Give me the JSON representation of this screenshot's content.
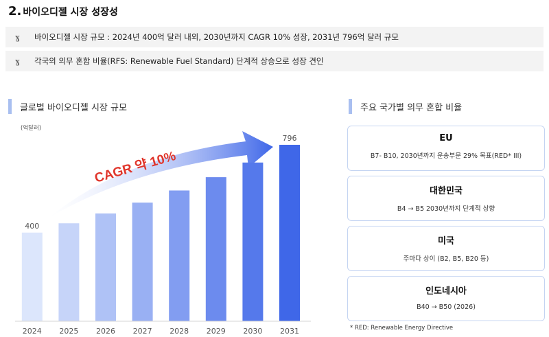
{
  "header": {
    "number": "2.",
    "title": "바이오디젤 시장 성장성"
  },
  "summary": [
    {
      "icon": "ɣ",
      "text": "바이오디젤 시장 규모 : 2024년 400억 달러 내외, 2030년까지 CAGR 10% 성장, 2031년 796억 달러 규모"
    },
    {
      "icon": "ɣ",
      "text": "각국의 의무 혼합 비율(RFS: Renewable Fuel Standard) 단계적 상승으로 성장 견인"
    }
  ],
  "left_section": {
    "title": "글로벌 바이오디젤 시장 규모",
    "unit": "(억달러)"
  },
  "right_section": {
    "title": "주요 국가별 의무 혼합 비율"
  },
  "countries": [
    {
      "name": "EU",
      "desc": "B7- B10, 2030년까지 운송부문 29% 목표(RED* III)"
    },
    {
      "name": "대한민국",
      "desc": "B4 → B5 2030년까지 단계적 상향"
    },
    {
      "name": "미국",
      "desc": "주마다 상이 (B2, B5, B20 등)"
    },
    {
      "name": "인도네시아",
      "desc": "B40 → B50 (2026)"
    }
  ],
  "footnote": "* RED: Renewable Energy Directive",
  "colors": {
    "accent_bar": "#a9bff0",
    "box_border": "#c4d4f2",
    "bar_light": "#dce6fc",
    "bar_dark": "#3f67e8",
    "cagr_text": "#e0352b"
  },
  "chart_data": {
    "type": "bar",
    "categories": [
      "2024",
      "2025",
      "2026",
      "2027",
      "2028",
      "2029",
      "2030",
      "2031"
    ],
    "values": [
      400,
      442,
      486,
      535,
      590,
      650,
      716,
      796
    ],
    "data_labels": {
      "2024": "400",
      "2031": "796"
    },
    "annotation": "CAGR 약 10%",
    "ylim": [
      0,
      830
    ],
    "title": "",
    "xlabel": "",
    "ylabel": "(억달러)",
    "grid": false
  }
}
